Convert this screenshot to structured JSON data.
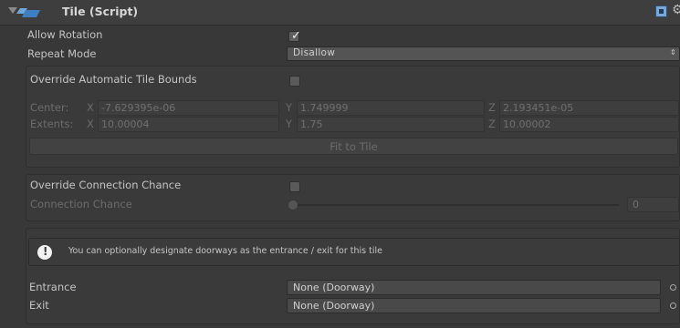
{
  "header": {
    "title": "Tile (Script)"
  },
  "allow_rotation": {
    "label": "Allow Rotation",
    "checked": true
  },
  "repeat_mode": {
    "label": "Repeat Mode",
    "value": "Disallow"
  },
  "bounds": {
    "override_label": "Override Automatic Tile Bounds",
    "override_checked": false,
    "center": {
      "label": "Center:",
      "x_label": "X",
      "x": "-7.629395e-06",
      "y_label": "Y",
      "y": "1.749999",
      "z_label": "Z",
      "z": "2.193451e-05"
    },
    "extents": {
      "label": "Extents:",
      "x_label": "X",
      "x": "10.00004",
      "y_label": "Y",
      "y": "1.75",
      "z_label": "Z",
      "z": "10.00002"
    },
    "fit_button": "Fit to Tile"
  },
  "connection": {
    "override_label": "Override Connection Chance",
    "override_checked": false,
    "chance_label": "Connection Chance",
    "chance_value": "0"
  },
  "doorways": {
    "info_text": "You can optionally designate doorways as the entrance / exit for this tile",
    "entrance_label": "Entrance",
    "entrance_value": "None (Doorway)",
    "exit_label": "Exit",
    "exit_value": "None (Doorway)"
  }
}
